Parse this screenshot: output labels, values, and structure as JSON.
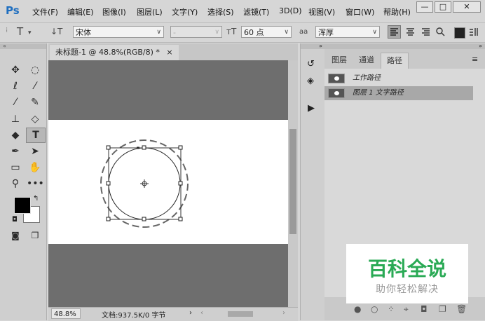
{
  "menubar": {
    "logo": "Ps",
    "items": [
      "文件(F)",
      "编辑(E)",
      "图像(I)",
      "图层(L)",
      "文字(Y)",
      "选择(S)",
      "滤镜(T)",
      "3D(D)",
      "视图(V)",
      "窗口(W)",
      "帮助(H)"
    ],
    "window_buttons": [
      "—",
      "□",
      "✕"
    ]
  },
  "options": {
    "text_tool_glyph": "T",
    "orient_glyph": "↓T",
    "font_family": "宋体",
    "font_style": "-",
    "size_glyph": "тT",
    "font_size": "60 点",
    "aa_glyph": "aa",
    "antialias": "浑厚"
  },
  "document": {
    "tab_title": "未标题-1 @ 48.8%(RGB/8) *",
    "zoom": "48.8%",
    "status": "文档:937.5K/0 字节"
  },
  "paths_panel": {
    "tabs": [
      "图层",
      "通道",
      "路径"
    ],
    "active_tab": "路径",
    "rows": [
      {
        "label": "工作路径",
        "selected": false
      },
      {
        "label": "图层 1 文字路径",
        "selected": true
      }
    ]
  },
  "watermark": {
    "title": "百科全说",
    "subtitle": "助你轻松解决",
    "color": "#2aaa55"
  }
}
